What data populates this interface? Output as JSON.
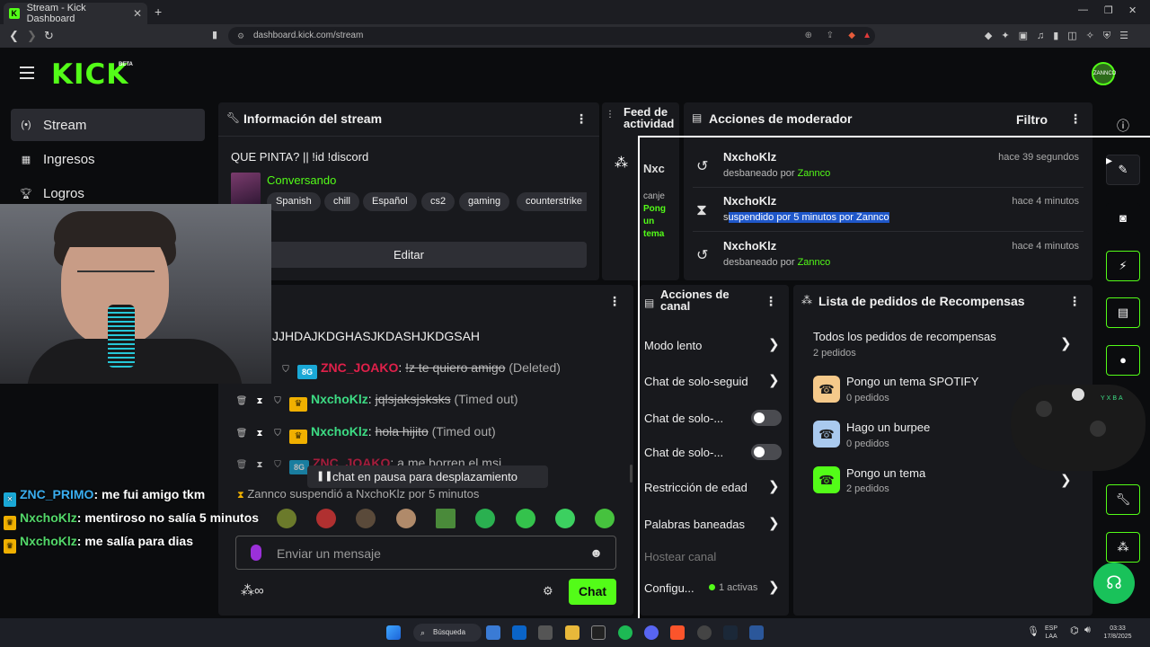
{
  "browser": {
    "tab_title": "Stream - Kick Dashboard",
    "url": "dashboard.kick.com/stream"
  },
  "brand": {
    "logo": "KICK",
    "beta": "BETA",
    "user_initials": "ZANNCO"
  },
  "sidebar": {
    "items": [
      {
        "label": "Stream",
        "icon": "broadcast-icon"
      },
      {
        "label": "Ingresos",
        "icon": "chart-icon"
      },
      {
        "label": "Logros",
        "icon": "trophy-icon"
      }
    ]
  },
  "stream_info": {
    "title": "Información del stream",
    "stream_title": "QUE PINTA? || !id !discord",
    "category": "Conversando",
    "tags": [
      "Spanish",
      "chill",
      "Español",
      "cs2",
      "gaming",
      "counterstrike"
    ],
    "edit_label": "Editar"
  },
  "feed": {
    "title_line1": "Feed de",
    "title_line2": "actividad",
    "item_name": "Nxc",
    "item_text1": "canje",
    "item_text2": "Pong",
    "item_text3": "un",
    "item_text4": "tema"
  },
  "chat": {
    "partial_line": "JJHDAJKDGHASJKDASHJKDGSAH",
    "messages": [
      {
        "user": "ZNC_JOAKO",
        "text": "!z te quiero amigo",
        "status": "(Deleted)"
      },
      {
        "user": "NxchoKlz",
        "text": "jqlsjaksjsksks",
        "status": "(Timed out)"
      },
      {
        "user": "NxchoKlz",
        "text": "hola hijito",
        "status": "(Timed out)"
      },
      {
        "user": "ZNC_JOAKO",
        "text": "a me borren el msj"
      }
    ],
    "system_line": "Zannco suspendió a NxchoKlz por 5 minutos",
    "paused_label": "chat en pausa para desplazamiento",
    "input_placeholder": "Enviar un mensaje",
    "send_label": "Chat"
  },
  "overlay_chat": [
    {
      "user": "ZNC_PRIMO",
      "text": ": me fui amigo tkm"
    },
    {
      "user": "NxchoKlz",
      "text": ": mentiroso no salía 5 minutos"
    },
    {
      "user": "NxchoKlz",
      "text": ": me salía para dias"
    }
  ],
  "mod_actions": {
    "title": "Acciones de moderador",
    "filter_label": "Filtro",
    "items": [
      {
        "user": "NxchoKlz",
        "desc": "desbaneado por ",
        "by": "Zannco",
        "time": "hace 39 segundos"
      },
      {
        "user": "NxchoKlz",
        "desc_s": "s",
        "desc_hl": "uspendido por 5 minutos por Zannco",
        "time": "hace 4 minutos"
      },
      {
        "user": "NxchoKlz",
        "desc": "desbaneado por ",
        "by": "Zannco",
        "time": "hace 4 minutos"
      }
    ]
  },
  "channel_actions": {
    "title_line1": "Acciones de",
    "title_line2": "canal",
    "items": [
      "Modo lento",
      "Chat de solo-seguid",
      "Chat de solo-...",
      "Chat de solo-...",
      "Restricción de edad",
      "Palabras baneadas",
      "Hostear canal",
      "Configu..."
    ],
    "config_badge": "1 activas"
  },
  "rewards": {
    "title": "Lista de pedidos de Recompensas",
    "all_label": "Todos los pedidos de recompensas",
    "all_count": "2 pedidos",
    "items": [
      {
        "name": "Pongo un tema SPOTIFY",
        "count": "0 pedidos",
        "color": "#f5c98a"
      },
      {
        "name": "Hago un burpee",
        "count": "0 pedidos",
        "color": "#a9c9ee"
      },
      {
        "name": "Pongo un tema",
        "count": "2 pedidos",
        "color": "#53fc18"
      }
    ]
  },
  "taskbar": {
    "search_label": "Búsqueda",
    "lang1": "ESP",
    "lang2": "LAA",
    "time": "03:33",
    "date": "17/8/2025"
  }
}
